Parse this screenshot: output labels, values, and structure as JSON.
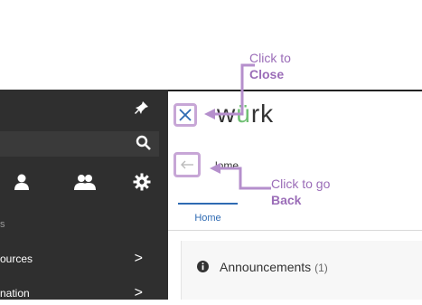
{
  "sidebar": {
    "small_label": "s",
    "items": [
      {
        "label": "ources",
        "chevron": ">"
      },
      {
        "label": "nation",
        "chevron": ">"
      }
    ]
  },
  "header": {
    "logo_text_before": "w",
    "logo_text_umlaut": "ü",
    "logo_text_after": "rk",
    "breadcrumb": "lome"
  },
  "tabs": [
    {
      "label": "Home"
    }
  ],
  "panel": {
    "title": "Announcements",
    "count": "(1)"
  },
  "annotations": {
    "close": {
      "line1": "Click to",
      "line2": "Close"
    },
    "back": {
      "line1": "Click to go",
      "line2": "Back"
    }
  },
  "colors": {
    "sidebar_bg": "#2f2f2f",
    "annotation": "#9b6db8",
    "highlight_border": "#c7a6d6",
    "logo_accent": "#6fbf73",
    "close_x": "#2f6bb3"
  },
  "icons": [
    "pin-icon",
    "search-icon",
    "user-icon",
    "users-icon",
    "gear-icon",
    "close-icon",
    "back-arrow-icon",
    "info-icon"
  ]
}
